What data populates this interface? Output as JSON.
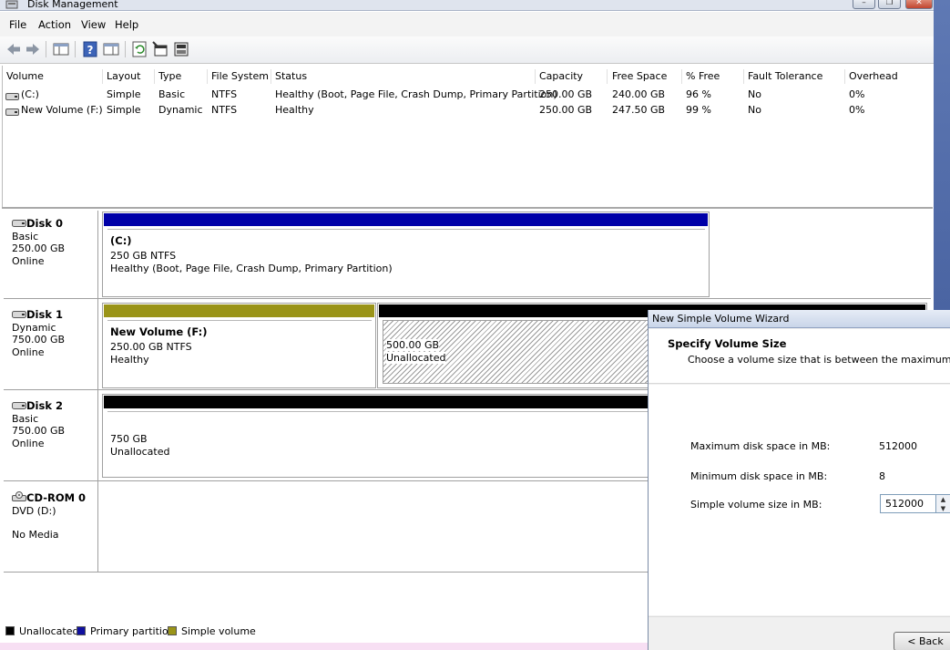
{
  "window": {
    "title": "Disk Management",
    "controls": {
      "minimize": "–",
      "maximize": "❐",
      "close": "✕"
    }
  },
  "menu": [
    "File",
    "Action",
    "View",
    "Help"
  ],
  "toolbar": {
    "icons": [
      "back-arrow-icon",
      "forward-arrow-icon",
      "console-tree-icon",
      "help-icon",
      "properties-list-icon",
      "refresh-icon",
      "properties-icon",
      "rescan-disks-icon"
    ]
  },
  "volume_list": {
    "columns": [
      "Volume",
      "Layout",
      "Type",
      "File System",
      "Status",
      "Capacity",
      "Free Space",
      "% Free",
      "Fault Tolerance",
      "Overhead"
    ],
    "rows": [
      [
        "(C:)",
        "Simple",
        "Basic",
        "NTFS",
        "Healthy (Boot, Page File, Crash Dump, Primary Partition)",
        "250.00 GB",
        "240.00 GB",
        "96 %",
        "No",
        "0%"
      ],
      [
        "New Volume (F:)",
        "Simple",
        "Dynamic",
        "NTFS",
        "Healthy",
        "250.00 GB",
        "247.50 GB",
        "99 %",
        "No",
        "0%"
      ]
    ]
  },
  "disks": [
    {
      "name": "Disk 0",
      "type": "Basic",
      "size": "250.00 GB",
      "status": "Online"
    },
    {
      "name": "Disk 1",
      "type": "Dynamic",
      "size": "750.00 GB",
      "status": "Online"
    },
    {
      "name": "Disk 2",
      "type": "Basic",
      "size": "750.00 GB",
      "status": "Online"
    },
    {
      "name": "CD-ROM 0",
      "type": "DVD (D:)",
      "status": "No Media"
    }
  ],
  "partitions": {
    "disk0_c": {
      "name": "(C:)",
      "size": "250 GB NTFS",
      "status": "Healthy (Boot, Page File, Crash Dump, Primary Partition)"
    },
    "disk1_f": {
      "name": "New Volume (F:)",
      "size": "250.00 GB NTFS",
      "status": "Healthy"
    },
    "disk1_unalloc": {
      "size": "500.00 GB",
      "status": "Unallocated"
    },
    "disk2_unalloc": {
      "size": "750 GB",
      "status": "Unallocated"
    }
  },
  "legend": [
    {
      "label": "Unallocated",
      "color": "#000000"
    },
    {
      "label": "Primary partition",
      "color": "#1010a0"
    },
    {
      "label": "Simple volume",
      "color": "#9a9418"
    }
  ],
  "colors": {
    "primary_partition": "#0000a8",
    "simple_volume": "#9a9418",
    "unallocated": "#000000"
  },
  "wizard": {
    "title": "New Simple Volume Wizard",
    "heading": "Specify Volume Size",
    "subheading": "Choose a volume size that is between the maximum and min",
    "max_label": "Maximum disk space in MB:",
    "max_value": "512000",
    "min_label": "Minimum disk space in MB:",
    "min_value": "8",
    "size_label": "Simple volume size in MB:",
    "size_value": "512000",
    "back_button": "< Back"
  }
}
